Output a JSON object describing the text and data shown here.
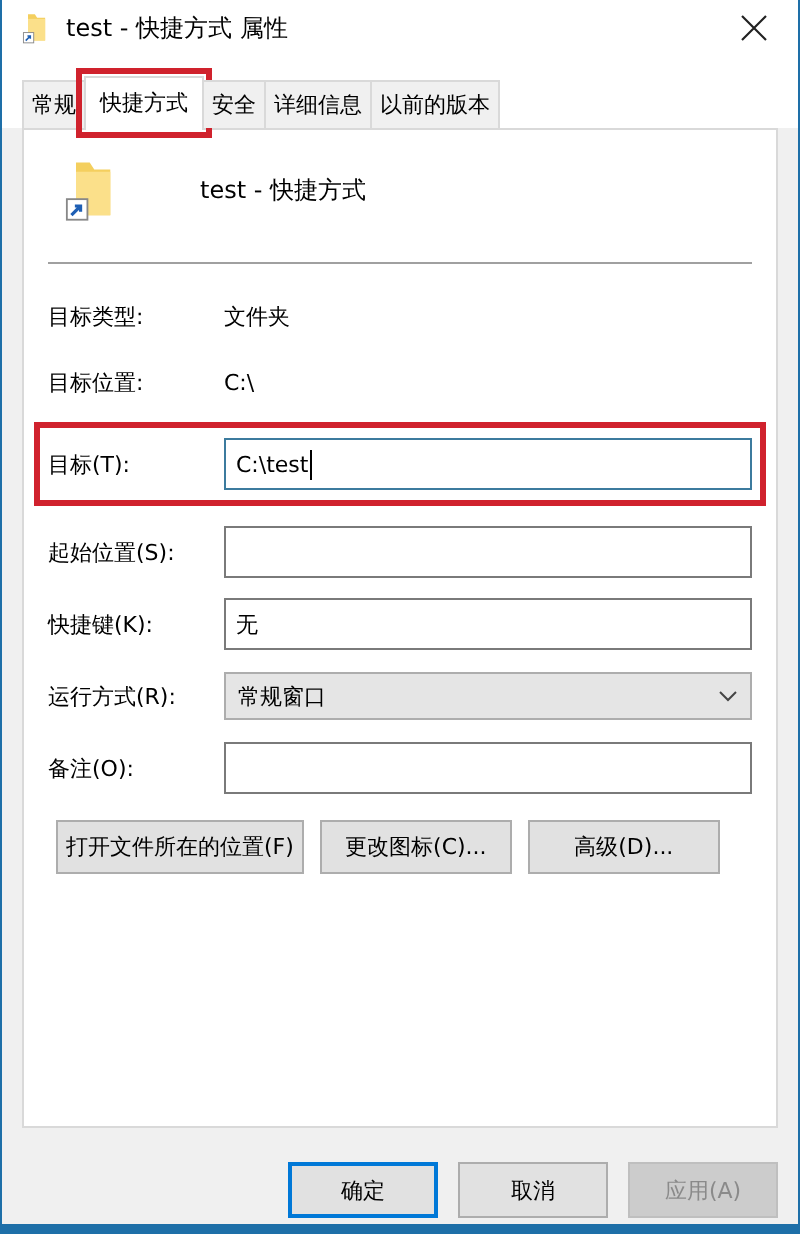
{
  "window": {
    "title": "test - 快捷方式 属性"
  },
  "tabs": [
    {
      "label": "常规",
      "selected": false,
      "highlighted": false
    },
    {
      "label": "快捷方式",
      "selected": true,
      "highlighted": true
    },
    {
      "label": "安全",
      "selected": false,
      "highlighted": false
    },
    {
      "label": "详细信息",
      "selected": false,
      "highlighted": false
    },
    {
      "label": "以前的版本",
      "selected": false,
      "highlighted": false
    }
  ],
  "header": {
    "name": "test - 快捷方式"
  },
  "rows": [
    {
      "kind": "text",
      "label": "目标类型:",
      "value": "文件夹"
    },
    {
      "kind": "text",
      "label": "目标位置:",
      "value": "C:\\"
    },
    {
      "kind": "field",
      "label": "目标(T):",
      "value": "C:\\test",
      "focused": true,
      "highlighted": true
    },
    {
      "kind": "field",
      "label": "起始位置(S):",
      "focused": false
    },
    {
      "kind": "field",
      "label": "快捷键(K):",
      "value": "无",
      "focused": false
    },
    {
      "kind": "dropdown",
      "label": "运行方式(R):",
      "value": "常规窗口"
    },
    {
      "kind": "field",
      "label": "备注(O):",
      "focused": false
    }
  ],
  "actions": [
    "打开文件所在的位置(F)",
    "更改图标(C)...",
    "高级(D)..."
  ],
  "buttons": [
    {
      "label": "确定",
      "default": true,
      "disabled": false
    },
    {
      "label": "取消",
      "default": false,
      "disabled": false
    },
    {
      "label": "应用(A)",
      "default": false,
      "disabled": true
    }
  ]
}
